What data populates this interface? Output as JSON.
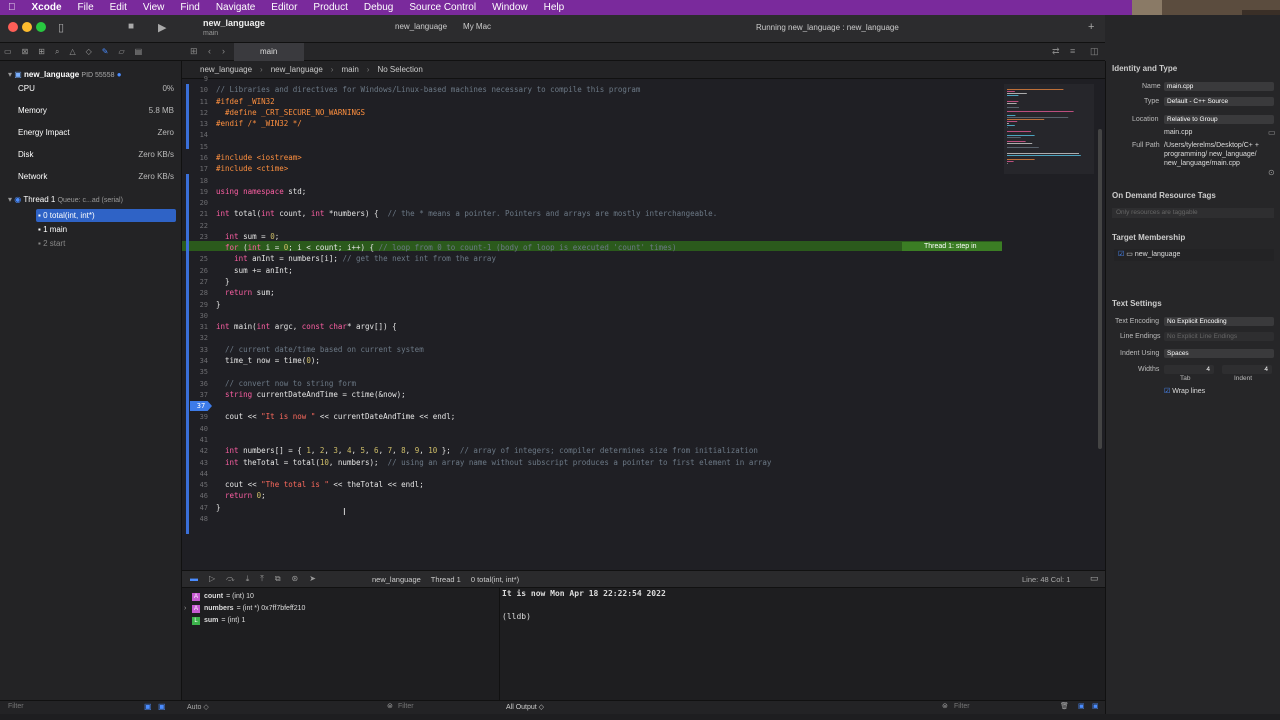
{
  "menubar": {
    "apple": "",
    "app": "Xcode",
    "items": [
      "File",
      "Edit",
      "View",
      "Find",
      "Navigate",
      "Editor",
      "Product",
      "Debug",
      "Source Control",
      "Window",
      "Help"
    ]
  },
  "toolbar": {
    "project": "new_language",
    "branch": "main",
    "scheme": "new_language",
    "destination": "My Mac",
    "status": "Running new_language : new_language",
    "tab": "main"
  },
  "navigator": {
    "process": {
      "name": "new_language",
      "pid": "PID 55558"
    },
    "gauges": [
      {
        "name": "CPU",
        "value": "0%"
      },
      {
        "name": "Memory",
        "value": "5.8 MB"
      },
      {
        "name": "Energy Impact",
        "value": "Zero"
      },
      {
        "name": "Disk",
        "value": "Zero KB/s"
      },
      {
        "name": "Network",
        "value": "Zero KB/s"
      }
    ],
    "thread": {
      "label": "Thread 1",
      "queue": "Queue: c...ad (serial)"
    },
    "frames": [
      "0 total(int, int*)",
      "1 main",
      "2 start"
    ],
    "filter": "Filter"
  },
  "jumpbar": {
    "items": [
      "new_language",
      "new_language",
      "main",
      "No Selection"
    ]
  },
  "editor": {
    "lines": [
      {
        "n": "9",
        "t": ""
      },
      {
        "n": "10",
        "t": "// Libraries and directives for Windows/Linux-based machines necessary to compile this program"
      },
      {
        "n": "11",
        "t": "#ifdef _WIN32"
      },
      {
        "n": "12",
        "t": "  #define _CRT_SECURE_NO_WARNINGS"
      },
      {
        "n": "13",
        "t": "#endif /* _WIN32 */"
      },
      {
        "n": "14",
        "t": ""
      },
      {
        "n": "15",
        "t": ""
      },
      {
        "n": "16",
        "t": "#include <iostream>"
      },
      {
        "n": "17",
        "t": "#include <ctime>"
      },
      {
        "n": "18",
        "t": ""
      },
      {
        "n": "19",
        "t": "using namespace std;"
      },
      {
        "n": "20",
        "t": ""
      },
      {
        "n": "21",
        "t": "int total(int count, int *numbers) {  // the * means a pointer. Pointers and arrays are mostly interchangeable."
      },
      {
        "n": "22",
        "t": ""
      },
      {
        "n": "23",
        "t": "  int sum = 0;"
      },
      {
        "n": "24",
        "t": "  for (int i = 0; i < count; i++) { // loop from 0 to count-1 (body of loop is executed 'count' times)"
      },
      {
        "n": "25",
        "t": "    int anInt = numbers[i]; // get the next int from the array"
      },
      {
        "n": "26",
        "t": "    sum += anInt;"
      },
      {
        "n": "27",
        "t": "  }"
      },
      {
        "n": "28",
        "t": "  return sum;"
      },
      {
        "n": "29",
        "t": "}"
      },
      {
        "n": "30",
        "t": ""
      },
      {
        "n": "31",
        "t": "int main(int argc, const char* argv[]) {"
      },
      {
        "n": "32",
        "t": ""
      },
      {
        "n": "33",
        "t": "  // current date/time based on current system"
      },
      {
        "n": "34",
        "t": "  time_t now = time(0);"
      },
      {
        "n": "35",
        "t": ""
      },
      {
        "n": "36",
        "t": "  // convert now to string form"
      },
      {
        "n": "37",
        "t": "  string currentDateAndTime = ctime(&now);"
      },
      {
        "n": "38",
        "t": ""
      },
      {
        "n": "39",
        "t": "  cout << \"It is now \" << currentDateAndTime << endl;"
      },
      {
        "n": "40",
        "t": ""
      },
      {
        "n": "41",
        "t": ""
      },
      {
        "n": "42",
        "t": "  int numbers[] = { 1, 2, 3, 4, 5, 6, 7, 8, 9, 10 };  // array of integers; compiler determines size from initialization"
      },
      {
        "n": "43",
        "t": "  int theTotal = total(10, numbers);  // using an array name without subscript produces a pointer to first element in array"
      },
      {
        "n": "44",
        "t": ""
      },
      {
        "n": "45",
        "t": "  cout << \"The total is \" << theTotal << endl;"
      },
      {
        "n": "46",
        "t": "  return 0;"
      },
      {
        "n": "47",
        "t": "}"
      },
      {
        "n": "48",
        "t": ""
      }
    ],
    "thread_annotation": "Thread 1: step in",
    "breakpoint_line": "37"
  },
  "debugbar": {
    "crumbs": [
      "new_language",
      "Thread 1",
      "0 total(int, int*)"
    ],
    "position": "Line: 48  Col: 1"
  },
  "variables": [
    {
      "name": "count",
      "value": "= (int) 10"
    },
    {
      "name": "numbers",
      "value": "= (int *) 0x7ff7bfeff210"
    },
    {
      "name": "sum",
      "value": "= (int) 1"
    }
  ],
  "console": {
    "output": "It is now Mon Apr 18 22:22:54 2022",
    "prompt": "(lldb)"
  },
  "bottom": {
    "auto": "Auto ◇",
    "filter": "Filter",
    "all_output": "All Output ◇",
    "filter2": "Filter"
  },
  "inspector": {
    "header": "Identity and Type",
    "name_label": "Name",
    "name_value": "main.cpp",
    "type_label": "Type",
    "type_value": "Default - C++ Source",
    "location_label": "Location",
    "location_value": "Relative to Group",
    "location_file": "main.cpp",
    "fullpath_label": "Full Path",
    "fullpath_value": "/Users/tylerelms/Desktop/C+ + programming/ new_language/ new_language/main.cpp",
    "odr_title": "On Demand Resource Tags",
    "odr_placeholder": "Only resources are taggable",
    "target_title": "Target Membership",
    "target_item": "new_language",
    "text_title": "Text Settings",
    "encoding_label": "Text Encoding",
    "encoding_value": "No Explicit Encoding",
    "endings_label": "Line Endings",
    "endings_value": "No Explicit Line Endings",
    "indent_label": "Indent Using",
    "indent_value": "Spaces",
    "widths_label": "Widths",
    "tab_value": "4",
    "indent_value2": "4",
    "tab_label": "Tab",
    "indent_label2": "Indent",
    "wrap_label": "Wrap lines"
  },
  "colors": {
    "keyword": "#fc5fa3",
    "preprocessor": "#fd8f3f",
    "string": "#fc6a5d",
    "comment": "#6c7986",
    "number": "#d0bf69",
    "type": "#5dd8ff",
    "accent": "#2f6fd6",
    "highlight": "#2d5a1e"
  }
}
